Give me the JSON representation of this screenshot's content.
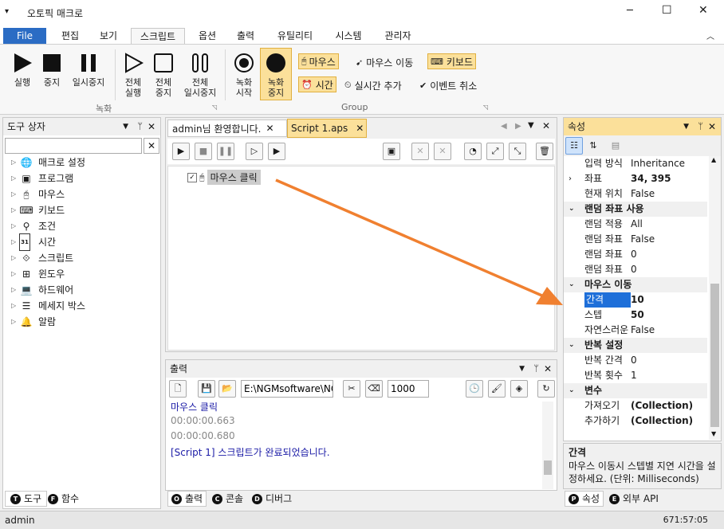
{
  "window": {
    "title": "오토픽 매크로",
    "menu_icon": "caret-down-icon",
    "minimize": "─",
    "maximize": "☐",
    "close": "✕"
  },
  "menu": {
    "file": "File",
    "items": [
      "편집",
      "보기",
      "스크립트",
      "옵션",
      "출력",
      "유틸리티",
      "시스템",
      "관리자"
    ],
    "active": "스크립트"
  },
  "ribbon": {
    "record_group": {
      "label": "녹화",
      "buttons": [
        "실행",
        "중지",
        "일시중지",
        "전체\n실행",
        "전체\n중지",
        "전체\n일시중지"
      ]
    },
    "group2": {
      "label": "Group",
      "buttons": [
        "녹화\n시작",
        "녹화\n중지"
      ],
      "toggles": {
        "mouse": "마우스",
        "mouse_move": "마우스 이동",
        "keyboard": "키보드",
        "time": "시간",
        "realtime_add": "실시간 추가",
        "event_cancel": "이벤트 취소"
      }
    }
  },
  "toolbox": {
    "title": "도구 상자",
    "search_placeholder": "",
    "items": [
      {
        "label": "매크로 설정",
        "icon": "globe-icon"
      },
      {
        "label": "프로그램",
        "icon": "program-icon"
      },
      {
        "label": "마우스",
        "icon": "mouse-icon"
      },
      {
        "label": "키보드",
        "icon": "keyboard-icon"
      },
      {
        "label": "조건",
        "icon": "condition-icon"
      },
      {
        "label": "시간",
        "icon": "calendar-icon"
      },
      {
        "label": "스크립트",
        "icon": "script-icon"
      },
      {
        "label": "윈도우",
        "icon": "windows-icon"
      },
      {
        "label": "하드웨어",
        "icon": "laptop-icon"
      },
      {
        "label": "메세지 박스",
        "icon": "message-icon"
      },
      {
        "label": "알람",
        "icon": "bell-icon"
      }
    ],
    "tabs": [
      "도구",
      "함수"
    ]
  },
  "editor": {
    "tabs": [
      "admin님 환영합니다.",
      "Script 1.aps"
    ],
    "active_tab": "Script 1.aps",
    "node": "마우스 클릭",
    "calendar_num": "31"
  },
  "output": {
    "title": "출력",
    "path": "E:\\NGMsoftware\\NG",
    "count": "1000",
    "lines": [
      {
        "text": "마우스 클릭",
        "color": "#1a1aa6"
      },
      {
        "text": "00:00:00.663",
        "color": "#888888"
      },
      {
        "text": "00:00:00.680",
        "color": "#888888"
      },
      {
        "text": "[Script 1] 스크립트가 완료되었습니다.",
        "color": "#1a1aa6"
      }
    ],
    "tabs": [
      "출력",
      "콘솔",
      "디버그"
    ]
  },
  "properties": {
    "title": "속성",
    "rows": [
      {
        "name": "입력 방식",
        "value": "Inheritance",
        "type": "row"
      },
      {
        "name": "좌표",
        "value": "34, 395",
        "type": "row",
        "expand": true,
        "bold": true
      },
      {
        "name": "현재 위치",
        "value": "False",
        "type": "row"
      },
      {
        "name": "랜덤 좌표 사용",
        "type": "cat"
      },
      {
        "name": "랜덤 적용",
        "value": "All",
        "type": "row"
      },
      {
        "name": "랜덤 좌표",
        "value": "False",
        "type": "row"
      },
      {
        "name": "랜덤 좌표",
        "value": "0",
        "type": "row"
      },
      {
        "name": "랜덤 좌표",
        "value": "0",
        "type": "row"
      },
      {
        "name": "마우스 이동",
        "type": "cat"
      },
      {
        "name": "간격",
        "value": "10",
        "type": "row",
        "selected": true,
        "bold": true
      },
      {
        "name": "스텝",
        "value": "50",
        "type": "row",
        "bold": true
      },
      {
        "name": "자연스러운",
        "value": "False",
        "type": "row"
      },
      {
        "name": "반복 설정",
        "type": "cat"
      },
      {
        "name": "반복 간격",
        "value": "0",
        "type": "row"
      },
      {
        "name": "반복 횟수",
        "value": "1",
        "type": "row"
      },
      {
        "name": "변수",
        "type": "cat"
      },
      {
        "name": "가져오기",
        "value": "(Collection)",
        "type": "row",
        "bold": true
      },
      {
        "name": "추가하기",
        "value": "(Collection)",
        "type": "row",
        "bold": true
      }
    ],
    "desc_title": "간격",
    "desc_text": "마우스 이동시 스텝별 지연 시간을 설정하세요. (단위: Milliseconds)",
    "tabs": [
      "속성",
      "외부 API"
    ]
  },
  "status": {
    "user": "admin",
    "time": "671:57:05"
  },
  "colors": {
    "accent": "#2b6cc4",
    "arrow": "#f08030",
    "highlight": "#fbe09a",
    "selected": "#1e6fd9"
  }
}
